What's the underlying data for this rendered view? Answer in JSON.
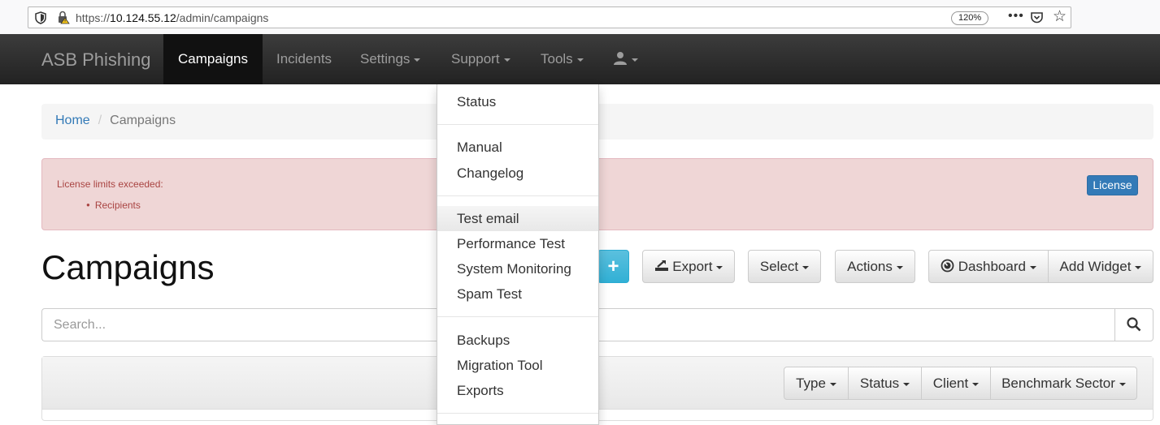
{
  "browser": {
    "url_prefix": "https://",
    "url_host": "10.124.55.12",
    "url_path": "/admin/campaigns",
    "zoom": "120%",
    "more_icon": "•••"
  },
  "navbar": {
    "brand": "ASB Phishing",
    "items": [
      {
        "label": "Campaigns",
        "active": true
      },
      {
        "label": "Incidents"
      },
      {
        "label": "Settings"
      },
      {
        "label": "Support"
      },
      {
        "label": "Tools"
      }
    ],
    "user_icon": "user-icon"
  },
  "breadcrumb": {
    "home": "Home",
    "separator": "/",
    "current": "Campaigns"
  },
  "alert": {
    "message": "License limits exceeded:",
    "items": [
      "Recipients"
    ],
    "button": "License"
  },
  "page": {
    "title": "Campaigns",
    "add_label": "+",
    "buttons": {
      "export": "Export",
      "select": "Select",
      "actions": "Actions",
      "dashboard": "Dashboard",
      "add_widget": "Add Widget"
    }
  },
  "search": {
    "placeholder": "Search..."
  },
  "filters": [
    "Type",
    "Status",
    "Client",
    "Benchmark Sector"
  ],
  "support_menu": {
    "groups": [
      [
        "Status"
      ],
      [
        "Manual",
        "Changelog"
      ],
      [
        "Test email",
        "Performance Test",
        "System Monitoring",
        "Spam Test"
      ],
      [
        "Backups",
        "Migration Tool",
        "Exports"
      ]
    ],
    "hovered": "Test email"
  },
  "colors": {
    "navbar": "#222222",
    "link": "#337ab7",
    "alert_bg": "#efd6d6",
    "alert_text": "#a94442",
    "info": "#5bc0de"
  }
}
